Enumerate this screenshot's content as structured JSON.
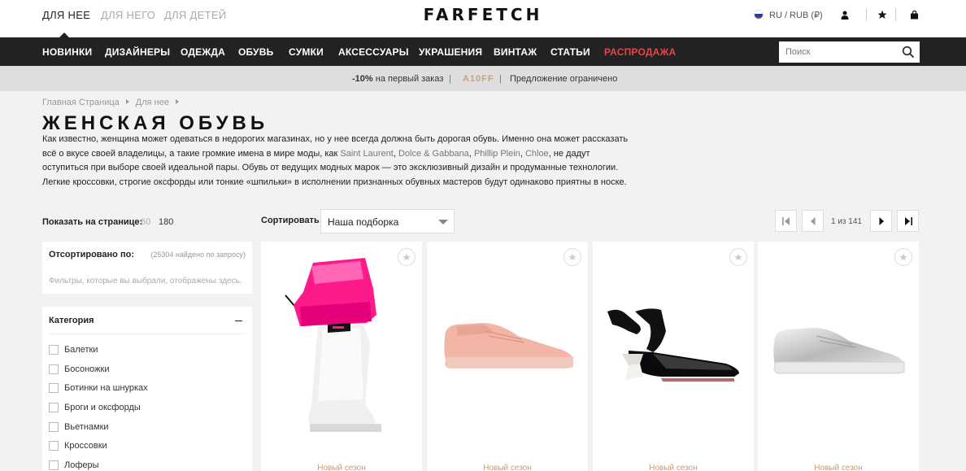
{
  "header": {
    "gender_tabs": [
      "ДЛЯ НЕЕ",
      "ДЛЯ НЕГО",
      "ДЛЯ ДЕТЕЙ"
    ],
    "logo": "FARFETCH",
    "locale": "RU / RUB (₽)",
    "icons": [
      "flag-russia-icon",
      "user-icon",
      "star-icon",
      "bag-icon"
    ]
  },
  "nav": {
    "items": [
      "НОВИНКИ",
      "ДИЗАЙНЕРЫ",
      "ОДЕЖДА",
      "ОБУВЬ",
      "СУМКИ",
      "АКСЕССУАРЫ",
      "УКРАШЕНИЯ",
      "ВИНТАЖ",
      "СТАТЬИ",
      "РАСПРОДАЖА"
    ],
    "search_placeholder": "Поиск",
    "sale_color": "#e8434a"
  },
  "promo": {
    "discount": "-10%",
    "discount_text": "на первый заказ",
    "code": "A10FF",
    "limited": "Предложение ограничено",
    "sep": "|"
  },
  "hero": {
    "breadcrumbs": [
      "Главная Страница",
      "Для нее"
    ],
    "title": "ЖЕНСКАЯ ОБУВЬ",
    "desc_1": "Как известно, женщина может одеваться в недорогих магазинах, но у нее всегда должна быть дорогая обувь. Именно она может рассказать всё о вкусе своей владелицы, а такие громкие имена в мире моды, как ",
    "brand_1": "Saint Laurent",
    "sep_1": ", ",
    "brand_2": "Dolce & Gabbana",
    "sep_2": ", ",
    "brand_3": "Phillip Plein",
    "sep_3": ", ",
    "brand_4": "Chloe",
    "desc_2": ", не дадут оступиться при выборе своей идеальной пары. Обувь от ведущих модных марок — это эксклюзивный дизайн и продуманные технологии. Легкие кроссовки, строгие оксфорды или тонкие «шпильки» в исполнении признанных обувных мастеров будут одинаково приятны в носке."
  },
  "listing": {
    "per_page_label": "Показать на странице:",
    "per_page_options": [
      "60",
      "180"
    ],
    "sort_label": "Сортировать",
    "sort_value": "Наша подборка",
    "pagination": "1 из 141"
  },
  "filters": {
    "sorted_label": "Отсортировано по:",
    "count": "(25304 найдено по запросу)",
    "note": "Фильтры, которые вы выбрали, отображены здесь.",
    "category_title": "Категория",
    "categories": [
      "Балетки",
      "Босоножки",
      "Ботинки на шнурках",
      "Броги и оксфорды",
      "Вьетнамки",
      "Кроссовки",
      "Лоферы"
    ]
  },
  "products": [
    {
      "season": "Новый сезон",
      "image": "pink-white-rain-boot"
    },
    {
      "season": "Новый сезон",
      "image": "pink-leather-sneaker"
    },
    {
      "season": "Новый сезон",
      "image": "black-patent-tie-heel"
    },
    {
      "season": "Новый сезон",
      "image": "silver-metallic-sneaker"
    }
  ]
}
